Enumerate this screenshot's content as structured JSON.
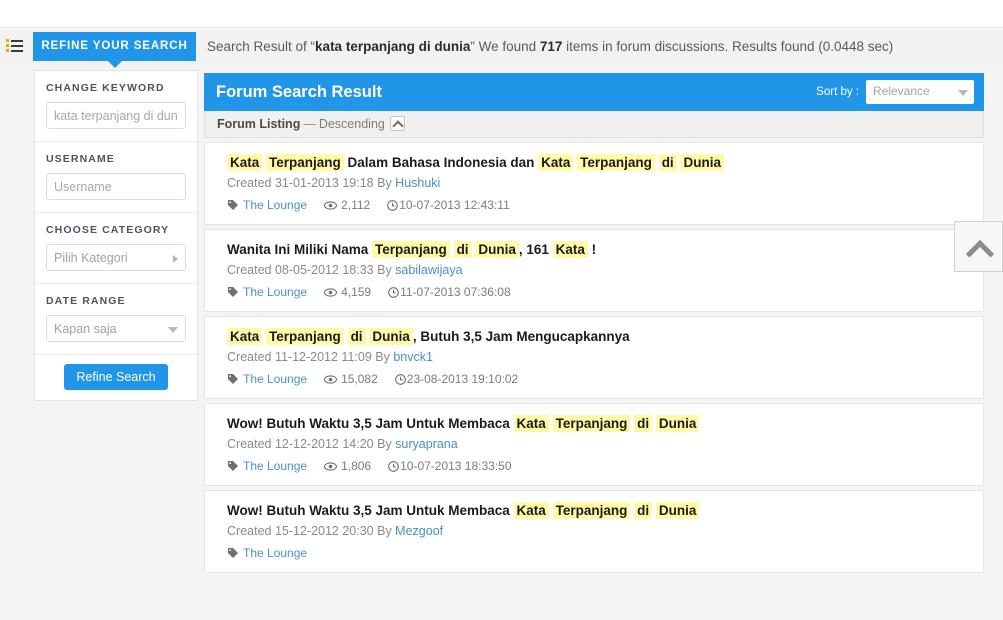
{
  "topbar": {
    "menu_icon": "list-menu-icon",
    "refine_tab_label": "REFINE YOUR SEARCH",
    "summary": {
      "prefix": "Search Result of “",
      "query": "kata terpanjang di dunia",
      "middle": "” We found ",
      "count": "717",
      "suffix": " items in forum discussions. Results found (0.0448 sec)"
    }
  },
  "sidebar": {
    "blocks": [
      {
        "label": "CHANGE KEYWORD",
        "control": "input",
        "placeholder": "kata terpanjang di dunia",
        "value": ""
      },
      {
        "label": "USERNAME",
        "control": "input",
        "placeholder": "Username",
        "value": ""
      },
      {
        "label": "CHOOSE CATEGORY",
        "control": "select-right",
        "value": "Pilih Kategori"
      },
      {
        "label": "DATE RANGE",
        "control": "select-down",
        "value": "Kapan saja"
      }
    ],
    "refine_button": "Refine Search"
  },
  "main": {
    "header_title": "Forum Search Result",
    "sort_by_label": "Sort by :",
    "sort_value": "Relevance",
    "listing_label": "Forum Listing",
    "listing_dash": "—",
    "listing_direction": "Descending",
    "sort_direction_icon": "chevron-up-icon"
  },
  "results": [
    {
      "title_parts": [
        {
          "t": "Kata",
          "h": true
        },
        {
          "t": " ",
          "h": false
        },
        {
          "t": "Terpanjang",
          "h": true
        },
        {
          "t": " Dalam Bahasa Indonesia dan ",
          "h": false
        },
        {
          "t": "Kata",
          "h": true
        },
        {
          "t": " ",
          "h": false
        },
        {
          "t": "Terpanjang",
          "h": true
        },
        {
          "t": " ",
          "h": false
        },
        {
          "t": "di",
          "h": true
        },
        {
          "t": " ",
          "h": false
        },
        {
          "t": "Dunia",
          "h": true
        }
      ],
      "created_prefix": "Created",
      "created_date": "31-01-2013 19:18",
      "by_label": "By",
      "author": "Hushuki",
      "forum": "The Lounge",
      "views": "2,112",
      "timestamp": "10-07-2013 12:43:11"
    },
    {
      "title_parts": [
        {
          "t": "Wanita Ini Miliki Nama ",
          "h": false
        },
        {
          "t": "Terpanjang",
          "h": true
        },
        {
          "t": " ",
          "h": false
        },
        {
          "t": "di",
          "h": true
        },
        {
          "t": " ",
          "h": false
        },
        {
          "t": "Dunia",
          "h": true
        },
        {
          "t": ", 161 ",
          "h": false
        },
        {
          "t": "Kata",
          "h": true
        },
        {
          "t": " !",
          "h": false
        }
      ],
      "created_prefix": "Created",
      "created_date": "08-05-2012 18:33",
      "by_label": "By",
      "author": "sabilawijaya",
      "forum": "The Lounge",
      "views": "4,159",
      "timestamp": "11-07-2013 07:36:08"
    },
    {
      "title_parts": [
        {
          "t": "Kata",
          "h": true
        },
        {
          "t": " ",
          "h": false
        },
        {
          "t": "Terpanjang",
          "h": true
        },
        {
          "t": " ",
          "h": false
        },
        {
          "t": "di",
          "h": true
        },
        {
          "t": " ",
          "h": false
        },
        {
          "t": "Dunia",
          "h": true
        },
        {
          "t": ", Butuh 3,5 Jam Mengucapkannya",
          "h": false
        }
      ],
      "created_prefix": "Created",
      "created_date": "11-12-2012 11:09",
      "by_label": "By",
      "author": "bnvck1",
      "forum": "The Lounge",
      "views": "15,082",
      "timestamp": "23-08-2013 19:10:02"
    },
    {
      "title_parts": [
        {
          "t": "Wow! Butuh Waktu 3,5 Jam Untuk Membaca ",
          "h": false
        },
        {
          "t": "Kata",
          "h": true
        },
        {
          "t": " ",
          "h": false
        },
        {
          "t": "Terpanjang",
          "h": true
        },
        {
          "t": " ",
          "h": false
        },
        {
          "t": "di",
          "h": true
        },
        {
          "t": " ",
          "h": false
        },
        {
          "t": "Dunia",
          "h": true
        }
      ],
      "created_prefix": "Created",
      "created_date": "12-12-2012 14:20",
      "by_label": "By",
      "author": "suryaprana",
      "forum": "The Lounge",
      "views": "1,806",
      "timestamp": "10-07-2013 18:33:50"
    },
    {
      "title_parts": [
        {
          "t": "Wow! Butuh Waktu 3,5 Jam Untuk Membaca ",
          "h": false
        },
        {
          "t": "Kata",
          "h": true
        },
        {
          "t": " ",
          "h": false
        },
        {
          "t": "Terpanjang",
          "h": true
        },
        {
          "t": " ",
          "h": false
        },
        {
          "t": "di",
          "h": true
        },
        {
          "t": " ",
          "h": false
        },
        {
          "t": "Dunia",
          "h": true
        }
      ],
      "created_prefix": "Created",
      "created_date": "15-12-2012 20:30",
      "by_label": "By",
      "author": "Mezgoof",
      "forum": "The Lounge",
      "views": "",
      "timestamp": ""
    }
  ],
  "scroll_top_button": {
    "icon": "chevron-up-icon"
  },
  "colors": {
    "accent_blue": "#2196e8",
    "highlight_yellow": "#fff9a8",
    "link_blue": "#4a90c4",
    "page_grey": "#f4f4f4"
  }
}
